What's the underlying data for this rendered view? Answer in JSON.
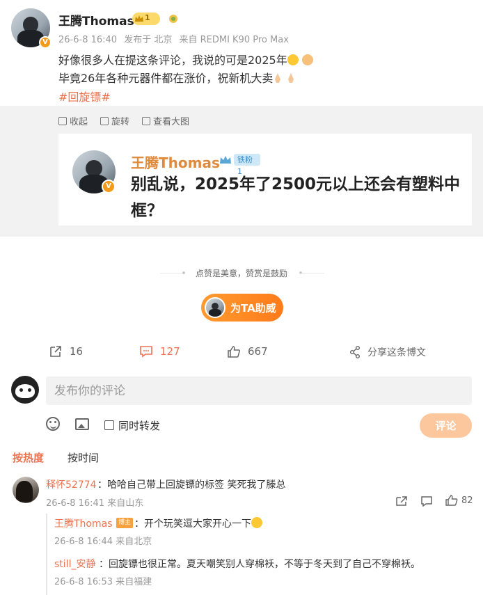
{
  "post": {
    "author": "王腾Thomas",
    "level": "1",
    "time": "26-6-8 16:40",
    "published_in": "发布于 北京",
    "source": "来自 REDMI K90 Pro Max",
    "line1": "好像很多人在提这条评论，我说的可是2025年",
    "line2": "毕竟26年各种元器件都在涨价，祝新机大卖",
    "hashtag": "#回旋镖#"
  },
  "image_tools": {
    "collapse": "收起",
    "rotate": "旋转",
    "view_large": "查看大图"
  },
  "quoted": {
    "author": "王腾Thomas",
    "fan_badge": "铁粉1",
    "text": "别乱说，2025年了2500元以上还会有塑料中框？"
  },
  "reward": {
    "slogan": "点赞是美意，赞赏是鼓励",
    "button": "为TA助威"
  },
  "actions": {
    "reposts": "16",
    "comments": "127",
    "likes": "667",
    "share": "分享这条博文"
  },
  "composer": {
    "placeholder": "发布你的评论",
    "repost_label": "同时转发",
    "submit": "评论"
  },
  "sort": {
    "hot": "按热度",
    "time": "按时间"
  },
  "comment": {
    "user": "释怀52774",
    "text": "哈哈自己带上回旋镖的标签 笑死我了滕总",
    "time": "26-6-8 16:41",
    "location": "来自山东",
    "likes": "82"
  },
  "replies": [
    {
      "user": "王腾Thomas",
      "badge": "博主",
      "text": "：开个玩笑逗大家开心一下",
      "time": "26-6-8 16:44",
      "location": "来自北京"
    },
    {
      "user": "still_安静",
      "text": "：回旋镖也很正常。夏天嘲笑别人穿棉袄，不等于冬天到了自己不穿棉袄。",
      "time": "26-6-8 16:53",
      "location": "来自福建"
    }
  ],
  "colors": {
    "accent": "#eb7350",
    "quote_author": "#e08a3c",
    "verified": "#f59b1a"
  }
}
